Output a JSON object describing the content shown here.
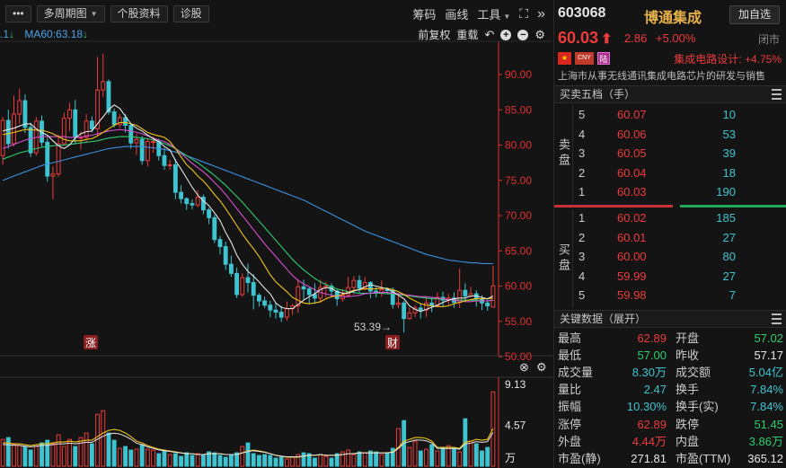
{
  "toolbar": {
    "more_label": "•••",
    "period_label": "多周期图",
    "stock_info_label": "个股资料",
    "diagnose_label": "诊股",
    "chip_label": "筹码",
    "draw_label": "画线",
    "tools_label": "工具",
    "collapse_label": "»"
  },
  "ma_row": {
    "legend_head": ".1",
    "ma60_text": "MA60:63.18",
    "fuquan_label": "前复权",
    "overlay_label": "重载"
  },
  "stock": {
    "code": "603068",
    "name": "博通集成",
    "add_button": "加自选",
    "price": "60.03",
    "change": "2.86",
    "change_pct": "+5.00%",
    "status": "闭市",
    "tag_cny": "CNY",
    "tag_lu": "陆",
    "sector": "集成电路设计: +4.75%",
    "description": "上海市从事无线通讯集成电路芯片的研发与销售"
  },
  "orderbook": {
    "title": "买卖五档（手）",
    "sell_label": "卖盘",
    "buy_label": "买盘",
    "asks": [
      {
        "level": "5",
        "price": "60.07",
        "volume": "10"
      },
      {
        "level": "4",
        "price": "60.06",
        "volume": "53"
      },
      {
        "level": "3",
        "price": "60.05",
        "volume": "39"
      },
      {
        "level": "2",
        "price": "60.04",
        "volume": "18"
      },
      {
        "level": "1",
        "price": "60.03",
        "volume": "190"
      }
    ],
    "bids": [
      {
        "level": "1",
        "price": "60.02",
        "volume": "185"
      },
      {
        "level": "2",
        "price": "60.01",
        "volume": "27"
      },
      {
        "level": "3",
        "price": "60.00",
        "volume": "80"
      },
      {
        "level": "4",
        "price": "59.99",
        "volume": "27"
      },
      {
        "level": "5",
        "price": "59.98",
        "volume": "7"
      }
    ]
  },
  "keydata": {
    "title": "关键数据（展开）",
    "rows": [
      {
        "l1": "最高",
        "v1": "62.89",
        "c1": "#ee3b3b",
        "l2": "开盘",
        "v2": "57.02",
        "c2": "#2ecc71"
      },
      {
        "l1": "最低",
        "v1": "57.00",
        "c1": "#2ecc71",
        "l2": "昨收",
        "v2": "57.17",
        "c2": "#e6e6e6"
      },
      {
        "l1": "成交量",
        "v1": "8.30万",
        "c1": "#3ec4d0",
        "l2": "成交额",
        "v2": "5.04亿",
        "c2": "#3ec4d0"
      },
      {
        "l1": "量比",
        "v1": "2.47",
        "c1": "#3ec4d0",
        "l2": "换手",
        "v2": "7.84%",
        "c2": "#3ec4d0"
      },
      {
        "l1": "振幅",
        "v1": "10.30%",
        "c1": "#3ec4d0",
        "l2": "换手(实)",
        "v2": "7.84%",
        "c2": "#3ec4d0"
      },
      {
        "l1": "涨停",
        "v1": "62.89",
        "c1": "#ee3b3b",
        "l2": "跌停",
        "v2": "51.45",
        "c2": "#2ecc71"
      },
      {
        "l1": "外盘",
        "v1": "4.44万",
        "c1": "#ee3b3b",
        "l2": "内盘",
        "v2": "3.86万",
        "c2": "#2ecc71"
      },
      {
        "l1": "市盈(静)",
        "v1": "271.81",
        "c1": "#e6e6e6",
        "l2": "市盈(TTM)",
        "v2": "365.12",
        "c2": "#e6e6e6"
      }
    ]
  },
  "chart_data": {
    "type": "candlestick",
    "price_axis": {
      "ticks": [
        "90.00",
        "85.00",
        "80.00",
        "75.00",
        "70.00",
        "65.00",
        "60.00",
        "55.00",
        "50.00"
      ],
      "range": [
        50,
        90
      ]
    },
    "volume_axis": {
      "ticks": [
        "9.13",
        "4.57"
      ],
      "unit": "万",
      "range": [
        0,
        9.13
      ]
    },
    "annotations": {
      "low_marker": "53.39→",
      "event_zhang": "涨",
      "event_cai": "财"
    },
    "colors": {
      "up": "#ee3b3b",
      "down": "#3ec4d0",
      "ma5": "#e6e6e6",
      "ma10": "#f0c419",
      "ma20": "#d94fcf",
      "ma30": "#2ecc71",
      "ma60": "#3a8fe0",
      "axis": "#e03030"
    },
    "candles": [
      [
        78.5,
        83.5,
        77.2,
        84.0
      ],
      [
        83.5,
        80.2,
        79.5,
        85.0
      ],
      [
        80.2,
        84.4,
        79.8,
        87.0
      ],
      [
        84.4,
        86.3,
        83.0,
        88.0
      ],
      [
        86.3,
        82.5,
        81.7,
        87.2
      ],
      [
        82.5,
        78.9,
        78.3,
        83.2
      ],
      [
        78.9,
        83.4,
        78.5,
        84.0
      ],
      [
        83.4,
        80.4,
        79.8,
        84.2
      ],
      [
        80.4,
        75.6,
        74.8,
        81.0
      ],
      [
        75.6,
        75.9,
        72.3,
        77.0
      ],
      [
        75.9,
        80.2,
        75.5,
        81.5
      ],
      [
        80.2,
        83.8,
        79.9,
        84.6
      ],
      [
        83.8,
        85.0,
        82.0,
        86.0
      ],
      [
        85.0,
        81.1,
        80.1,
        86.4
      ],
      [
        81.1,
        81.1,
        79.4,
        81.9
      ],
      [
        81.1,
        83.4,
        80.4,
        84.4
      ],
      [
        83.4,
        82.3,
        81.8,
        84.1
      ],
      [
        82.3,
        87.8,
        81.3,
        92.5
      ],
      [
        87.8,
        89.0,
        86.8,
        93.0
      ],
      [
        89.0,
        84.7,
        84.3,
        89.3
      ],
      [
        84.7,
        82.9,
        82.5,
        85.2
      ],
      [
        82.9,
        83.9,
        82.5,
        84.4
      ],
      [
        83.9,
        82.8,
        81.8,
        84.4
      ],
      [
        82.8,
        80.3,
        79.5,
        83.1
      ],
      [
        80.3,
        80.8,
        78.6,
        81.6
      ],
      [
        80.8,
        77.8,
        77.2,
        81.3
      ],
      [
        77.8,
        80.5,
        77.0,
        80.9
      ],
      [
        80.5,
        80.5,
        78.9,
        81.2
      ],
      [
        80.5,
        78.5,
        77.8,
        80.9
      ],
      [
        78.5,
        77.1,
        76.5,
        79.6
      ],
      [
        77.1,
        77.2,
        76.5,
        77.9
      ],
      [
        77.2,
        73.3,
        72.3,
        78.0
      ],
      [
        73.3,
        72.4,
        71.7,
        74.3
      ],
      [
        72.4,
        71.7,
        70.8,
        72.6
      ],
      [
        71.7,
        71.5,
        70.9,
        72.3
      ],
      [
        71.5,
        72.6,
        71.2,
        73.6
      ],
      [
        72.6,
        70.8,
        70.2,
        73.0
      ],
      [
        70.8,
        69.7,
        68.8,
        71.1
      ],
      [
        69.7,
        66.6,
        66.1,
        70.1
      ],
      [
        66.6,
        65.6,
        64.5,
        67.1
      ],
      [
        65.6,
        63.1,
        62.3,
        66.3
      ],
      [
        63.1,
        61.8,
        61.3,
        64.3
      ],
      [
        61.8,
        58.8,
        58.3,
        62.6
      ],
      [
        58.8,
        61.2,
        58.5,
        61.8
      ],
      [
        61.2,
        60.5,
        59.1,
        63.2
      ],
      [
        60.5,
        58.7,
        56.7,
        61.7
      ],
      [
        58.7,
        57.9,
        57.1,
        59.0
      ],
      [
        57.9,
        57.3,
        56.9,
        58.5
      ],
      [
        57.3,
        56.6,
        55.6,
        57.9
      ],
      [
        56.6,
        56.3,
        55.4,
        57.6
      ],
      [
        56.3,
        55.6,
        54.9,
        57.2
      ],
      [
        55.6,
        56.8,
        55.1,
        57.8
      ],
      [
        56.8,
        57.2,
        55.9,
        57.5
      ],
      [
        57.2,
        59.9,
        56.2,
        61.0
      ],
      [
        59.9,
        59.6,
        58.1,
        60.9
      ],
      [
        59.6,
        58.8,
        57.4,
        59.9
      ],
      [
        58.8,
        58.3,
        57.5,
        60.4
      ],
      [
        58.3,
        59.8,
        57.6,
        60.9
      ],
      [
        59.8,
        60.0,
        58.4,
        60.6
      ],
      [
        60.0,
        59.3,
        58.4,
        60.4
      ],
      [
        59.3,
        58.2,
        57.2,
        59.5
      ],
      [
        58.2,
        58.7,
        57.8,
        59.6
      ],
      [
        58.7,
        59.8,
        58.5,
        61.3
      ],
      [
        59.8,
        60.8,
        58.8,
        61.4
      ],
      [
        60.8,
        59.7,
        59.1,
        61.5
      ],
      [
        59.7,
        60.5,
        59.4,
        61.3
      ],
      [
        60.5,
        59.3,
        58.3,
        60.7
      ],
      [
        59.3,
        59.1,
        58.4,
        59.9
      ],
      [
        59.1,
        59.5,
        58.5,
        60.8
      ],
      [
        59.5,
        59.4,
        59.0,
        59.8
      ],
      [
        59.4,
        57.4,
        56.8,
        59.8
      ],
      [
        57.4,
        57.6,
        56.9,
        58.8
      ],
      [
        57.6,
        55.4,
        53.4,
        57.9
      ],
      [
        55.4,
        56.2,
        55.2,
        57.0
      ],
      [
        56.2,
        56.9,
        55.6,
        57.3
      ],
      [
        56.9,
        56.6,
        55.4,
        57.6
      ],
      [
        56.6,
        57.6,
        55.6,
        58.3
      ],
      [
        57.6,
        57.2,
        56.3,
        58.4
      ],
      [
        57.2,
        58.4,
        57.0,
        59.1
      ],
      [
        58.4,
        58.0,
        57.0,
        59.2
      ],
      [
        58.0,
        58.3,
        57.3,
        58.9
      ],
      [
        58.3,
        57.7,
        56.9,
        59.1
      ],
      [
        57.7,
        59.4,
        56.9,
        62.5
      ],
      [
        59.4,
        58.6,
        58.0,
        60.4
      ],
      [
        58.6,
        58.9,
        58.4,
        59.9
      ],
      [
        58.9,
        58.2,
        57.1,
        59.4
      ],
      [
        58.2,
        57.6,
        56.6,
        58.7
      ],
      [
        57.6,
        57.2,
        56.5,
        58.1
      ],
      [
        57.02,
        60.03,
        57.0,
        62.89
      ]
    ],
    "ma": {
      "ma5": [
        82.0,
        82.2,
        82.4,
        82.7,
        83.0,
        83.0,
        82.3,
        81.8,
        81.4,
        80.6,
        79.9,
        79.5,
        80.0,
        81.0,
        81.6,
        81.9,
        82.0,
        83.0,
        84.0,
        85.0,
        85.7,
        85.2,
        84.1,
        83.0,
        82.4,
        82.0,
        81.4,
        80.9,
        80.5,
        79.8,
        79.3,
        77.8,
        76.6,
        75.3,
        74.0,
        72.9,
        72.1,
        71.4,
        70.4,
        69.3,
        67.6,
        66.2,
        64.4,
        63.1,
        62.1,
        61.4,
        60.6,
        59.7,
        58.9,
        57.6,
        57.0,
        56.8,
        56.8,
        57.4,
        58.0,
        58.5,
        58.9,
        59.5,
        59.8,
        59.7,
        59.2,
        59.0,
        59.0,
        59.3,
        59.5,
        59.9,
        60.2,
        60.0,
        59.8,
        59.6,
        59.2,
        58.7,
        58.2,
        57.2,
        56.7,
        56.4,
        56.7,
        57.0,
        57.3,
        57.7,
        58.0,
        58.2,
        58.3,
        58.3,
        58.6,
        58.6,
        58.4,
        58.2,
        58.6
      ],
      "ma10": [
        81.5,
        81.6,
        81.8,
        82.0,
        82.2,
        82.2,
        82.1,
        82.1,
        81.9,
        81.6,
        81.2,
        80.8,
        80.6,
        80.6,
        80.6,
        80.8,
        80.9,
        81.3,
        81.8,
        82.3,
        82.8,
        83.2,
        83.2,
        83.0,
        82.8,
        82.3,
        81.8,
        81.5,
        81.3,
        81.1,
        80.5,
        79.5,
        78.3,
        77.2,
        76.5,
        75.6,
        74.9,
        74.0,
        73.0,
        72.1,
        71.0,
        69.8,
        68.6,
        67.4,
        66.3,
        65.3,
        64.2,
        62.9,
        61.6,
        60.6,
        59.9,
        59.2,
        58.4,
        58.0,
        57.6,
        57.5,
        57.6,
        57.8,
        58.2,
        58.5,
        58.6,
        58.8,
        59.1,
        59.4,
        59.5,
        59.6,
        59.6,
        59.6,
        59.7,
        59.7,
        59.5,
        59.2,
        58.8,
        58.3,
        57.9,
        57.5,
        57.3,
        57.2,
        57.1,
        57.1,
        57.2,
        57.5,
        57.7,
        57.9,
        58.1,
        58.2,
        58.2,
        58.2,
        58.3
      ],
      "ma20": [
        79.5,
        79.8,
        80.1,
        80.4,
        80.7,
        80.9,
        81.1,
        81.2,
        81.2,
        81.2,
        81.2,
        81.2,
        81.1,
        81.1,
        81.1,
        81.3,
        81.4,
        81.6,
        81.8,
        82.0,
        82.1,
        82.2,
        82.1,
        82.0,
        81.8,
        81.6,
        81.3,
        81.0,
        80.7,
        80.5,
        80.1,
        79.5,
        78.8,
        78.1,
        77.4,
        76.8,
        76.2,
        75.5,
        74.7,
        73.9,
        73.0,
        72.0,
        71.0,
        70.0,
        69.0,
        68.0,
        67.0,
        66.0,
        65.1,
        64.2,
        63.3,
        62.4,
        61.5,
        60.8,
        60.3,
        59.9,
        59.5,
        59.1,
        58.9,
        58.7,
        58.6,
        58.5,
        58.5,
        58.6,
        58.7,
        58.9,
        59.0,
        59.1,
        59.1,
        59.1,
        59.0,
        58.9,
        58.8,
        58.7,
        58.6,
        58.5,
        58.5,
        58.4,
        58.3,
        58.2,
        58.1,
        58.0,
        57.9,
        57.8,
        57.8,
        57.9,
        57.9,
        57.9,
        58.0
      ],
      "ma30": [
        78.0,
        78.3,
        78.6,
        78.9,
        79.1,
        79.3,
        79.5,
        79.7,
        79.8,
        79.9,
        80.0,
        80.0,
        80.1,
        80.2,
        80.3,
        80.4,
        80.5,
        80.6,
        80.8,
        81.0,
        81.1,
        81.2,
        81.2,
        81.2,
        81.1,
        81.0,
        80.9,
        80.7,
        80.5,
        80.2,
        79.9,
        79.5,
        79.0,
        78.5,
        78.0,
        77.5,
        76.9,
        76.3,
        75.7,
        75.0,
        74.3,
        73.5,
        72.7,
        71.9,
        71.0,
        70.1,
        69.2,
        68.3,
        67.4,
        66.5,
        65.6,
        64.7,
        63.8,
        63.0,
        62.3,
        61.7,
        61.1,
        60.6,
        60.2,
        59.9,
        59.6,
        59.4,
        59.2,
        59.1,
        59.0,
        59.0,
        59.0,
        59.0,
        59.0,
        58.9,
        58.9,
        58.8,
        58.7,
        58.6,
        58.5,
        58.4,
        58.3,
        58.2,
        58.2,
        58.1,
        58.1,
        58.0,
        58.0,
        58.0,
        58.0,
        58.0,
        57.9,
        57.9,
        58.0
      ],
      "ma60": [
        75.0,
        75.3,
        75.6,
        75.9,
        76.2,
        76.5,
        76.8,
        77.1,
        77.3,
        77.5,
        77.7,
        77.9,
        78.1,
        78.3,
        78.5,
        78.7,
        78.9,
        79.1,
        79.3,
        79.5,
        79.6,
        79.7,
        79.8,
        79.8,
        79.8,
        79.8,
        79.7,
        79.6,
        79.5,
        79.4,
        79.2,
        79.0,
        78.8,
        78.5,
        78.2,
        77.9,
        77.6,
        77.3,
        77.0,
        76.7,
        76.4,
        76.1,
        75.8,
        75.5,
        75.2,
        74.9,
        74.6,
        74.3,
        74.0,
        73.7,
        73.4,
        73.1,
        72.8,
        72.5,
        72.2,
        71.8,
        71.4,
        71.0,
        70.6,
        70.2,
        69.8,
        69.4,
        69.0,
        68.6,
        68.2,
        67.8,
        67.5,
        67.2,
        66.9,
        66.6,
        66.3,
        66.0,
        65.7,
        65.4,
        65.1,
        64.8,
        64.5,
        64.3,
        64.1,
        63.9,
        63.7,
        63.6,
        63.5,
        63.4,
        63.3,
        63.3,
        63.2,
        63.2,
        63.18
      ]
    },
    "volumes": [
      3.0,
      3.2,
      2.4,
      2.3,
      2.2,
      1.8,
      2.2,
      2.6,
      2.9,
      2.5,
      3.5,
      2.2,
      3.0,
      2.2,
      3.2,
      3.7,
      2.5,
      5.8,
      6.2,
      3.7,
      2.9,
      2.0,
      2.2,
      1.8,
      1.9,
      2.4,
      1.9,
      1.8,
      1.4,
      1.7,
      1.3,
      1.4,
      1.1,
      1.5,
      1.2,
      1.4,
      1.2,
      1.6,
      1.5,
      1.2,
      1.0,
      1.2,
      1.5,
      2.2,
      2.6,
      1.4,
      1.2,
      1.3,
      1.2,
      0.9,
      1.0,
      0.8,
      1.0,
      1.3,
      1.5,
      1.4,
      0.9,
      1.3,
      1.1,
      0.9,
      1.4,
      1.6,
      1.8,
      1.3,
      1.6,
      1.5,
      1.7,
      1.6,
      1.3,
      1.4,
      2.0,
      4.2,
      5.1,
      2.1,
      2.8,
      1.7,
      1.9,
      2.4,
      1.7,
      2.0,
      2.3,
      2.0,
      1.6,
      5.3,
      2.8,
      2.5,
      1.7,
      2.1,
      8.3
    ],
    "vol_ma": [
      2.6,
      2.6,
      2.5,
      2.5,
      2.4,
      2.3,
      2.4,
      2.5,
      2.5,
      2.6,
      2.7,
      2.7,
      2.8,
      2.7,
      2.8,
      2.9,
      2.9,
      3.3,
      3.7,
      4.0,
      4.1,
      4.0,
      3.7,
      3.3,
      2.8,
      2.6,
      2.3,
      2.1,
      1.9,
      1.8,
      1.7,
      1.6,
      1.5,
      1.4,
      1.4,
      1.3,
      1.3,
      1.4,
      1.4,
      1.4,
      1.3,
      1.3,
      1.3,
      1.5,
      1.7,
      1.8,
      1.7,
      1.6,
      1.4,
      1.2,
      1.1,
      1.0,
      1.0,
      1.0,
      1.1,
      1.2,
      1.2,
      1.3,
      1.2,
      1.2,
      1.2,
      1.3,
      1.4,
      1.4,
      1.5,
      1.5,
      1.5,
      1.5,
      1.5,
      1.5,
      1.6,
      2.1,
      2.8,
      3.0,
      3.2,
      3.2,
      3.1,
      2.8,
      2.1,
      2.1,
      2.1,
      2.1,
      2.0,
      2.7,
      2.8,
      3.0,
      2.9,
      3.0,
      4.2
    ]
  }
}
